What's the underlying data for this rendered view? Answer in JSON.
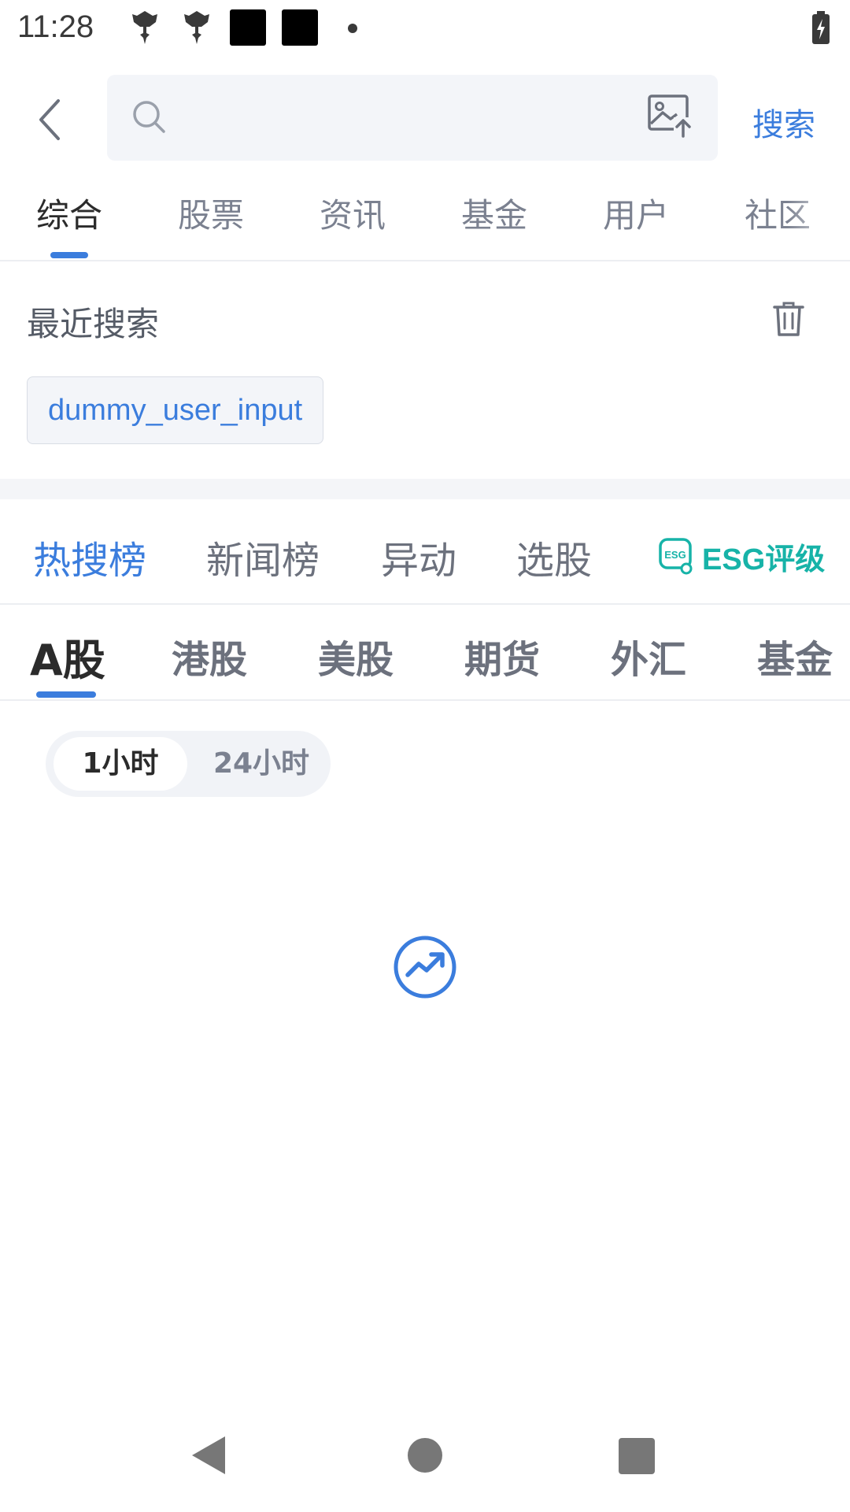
{
  "status_bar": {
    "time": "11:28"
  },
  "search": {
    "placeholder": "",
    "button_label": "搜索"
  },
  "top_tabs": [
    "综合",
    "股票",
    "资讯",
    "基金",
    "用户",
    "社区"
  ],
  "recent": {
    "title": "最近搜索",
    "chips": [
      "dummy_user_input"
    ]
  },
  "rank_tabs": {
    "items": [
      "热搜榜",
      "新闻榜",
      "异动",
      "选股"
    ],
    "esg_label": "ESG评级"
  },
  "market_tabs": [
    "A股",
    "港股",
    "美股",
    "期货",
    "外汇",
    "基金"
  ],
  "time_toggle": {
    "options": [
      "1小时",
      "24小时"
    ],
    "selected": "1小时"
  },
  "colors": {
    "accent": "#3b7ddd",
    "esg": "#17b3a8"
  }
}
